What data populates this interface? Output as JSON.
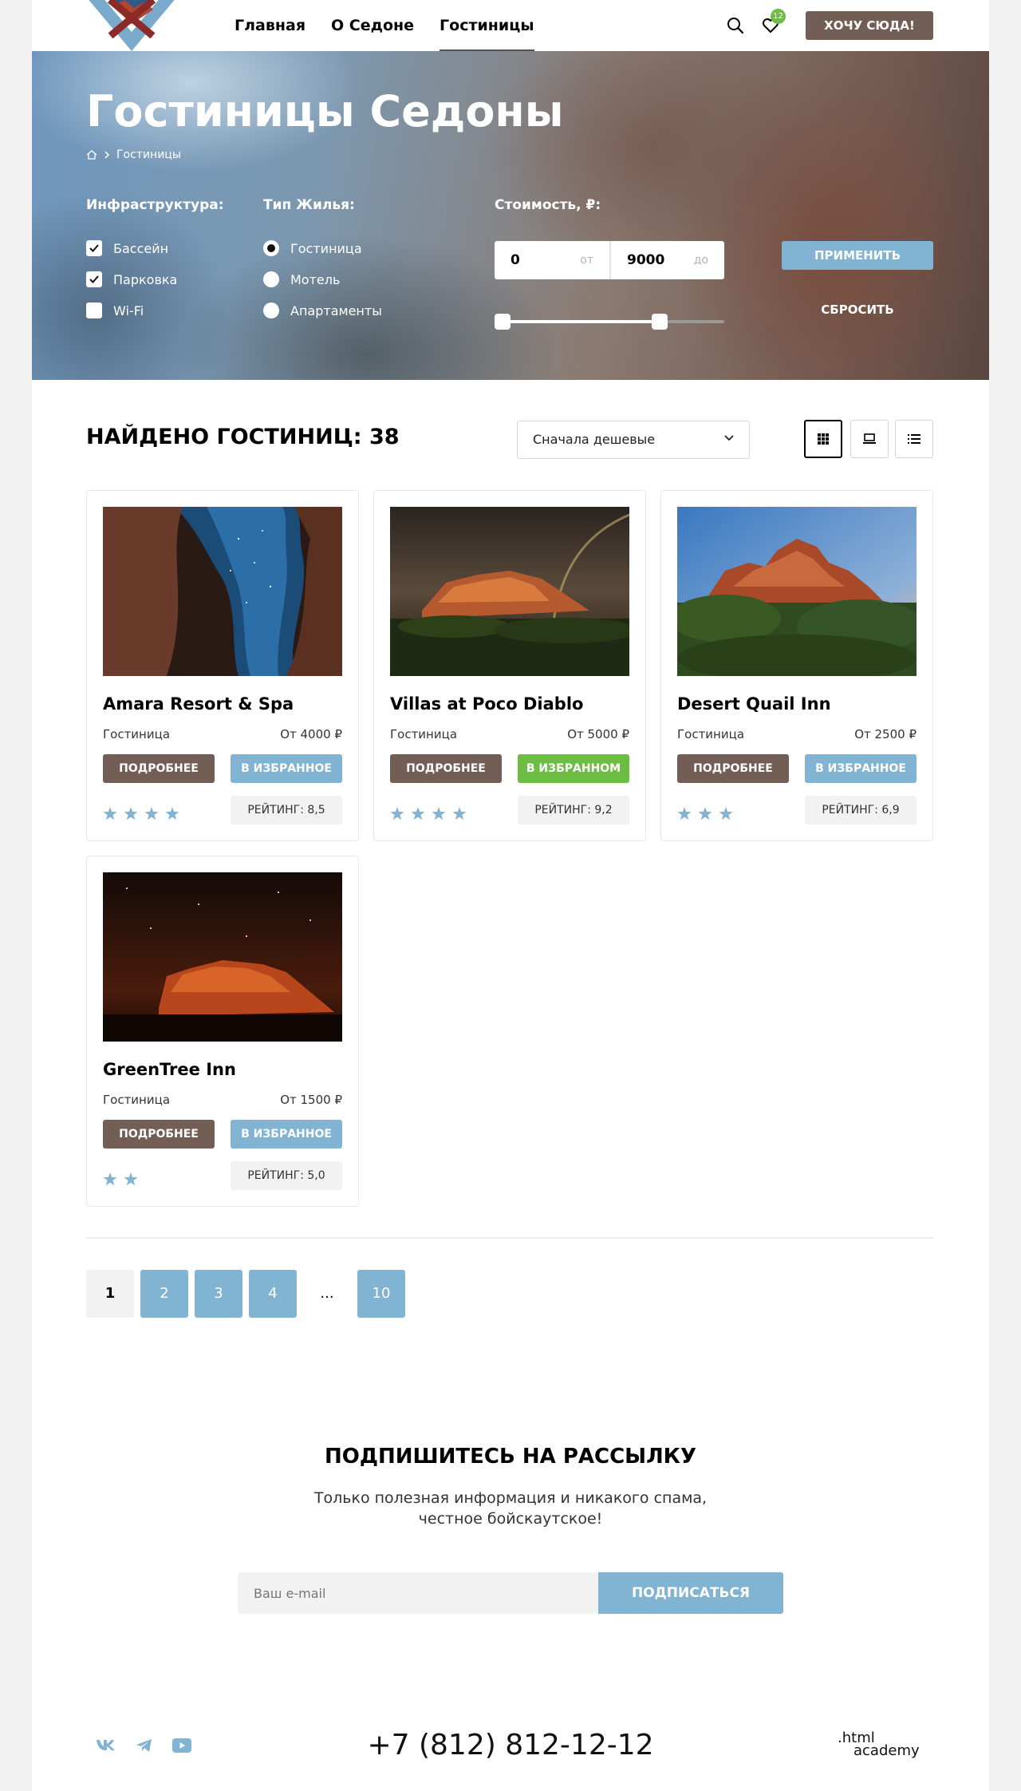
{
  "header": {
    "logo_alt": "City of Sedona",
    "nav": [
      {
        "label": "Главная",
        "active": false
      },
      {
        "label": "О Седоне",
        "active": false
      },
      {
        "label": "Гостиницы",
        "active": true
      }
    ],
    "favorites_count": "12",
    "cta_label": "ХОЧУ СЮДА!"
  },
  "hero": {
    "title": "Гостиницы Седоны",
    "breadcrumb_current": "Гостиницы"
  },
  "filters": {
    "infrastructure_title": "Инфраструктура:",
    "infrastructure": [
      {
        "label": "Бассейн",
        "checked": true
      },
      {
        "label": "Парковка",
        "checked": true
      },
      {
        "label": "Wi-Fi",
        "checked": false
      }
    ],
    "type_title": "Тип Жилья:",
    "types": [
      {
        "label": "Гостиница",
        "selected": true
      },
      {
        "label": "Мотель",
        "selected": false
      },
      {
        "label": "Апартаменты",
        "selected": false
      }
    ],
    "price_title": "Стоимость, ₽:",
    "price_min": "0",
    "price_min_unit": "от",
    "price_max": "9000",
    "price_max_unit": "до",
    "range_min_fraction": 0.0,
    "range_max_fraction": 0.72,
    "apply_label": "ПРИМЕНИТЬ",
    "reset_label": "СБРОСИТЬ"
  },
  "results": {
    "found_label": "НАЙДЕНО ГОСТИНИЦ: 38",
    "sort_value": "Сначала дешевые",
    "view_modes": [
      "grid",
      "card",
      "list"
    ],
    "active_view": "grid"
  },
  "hotels": [
    {
      "name": "Amara Resort & Spa",
      "type": "Гостиница",
      "price": "От 4000 ₽",
      "more_label": "ПОДРОБНЕЕ",
      "fav_label": "В ИЗБРАННОЕ",
      "in_favorites": false,
      "stars": 4,
      "rating": "РЕЙТИНГ: 8,5",
      "image": "cave-night-sky"
    },
    {
      "name": "Villas at Poco Diablo",
      "type": "Гостиница",
      "price": "От 5000 ₽",
      "more_label": "ПОДРОБНЕЕ",
      "fav_label": "В ИЗБРАННОМ",
      "in_favorites": true,
      "stars": 4,
      "rating": "РЕЙТИНГ: 9,2",
      "image": "red-rock-rainbow"
    },
    {
      "name": "Desert Quail Inn",
      "type": "Гостиница",
      "price": "От 2500 ₽",
      "more_label": "ПОДРОБНЕЕ",
      "fav_label": "В ИЗБРАННОЕ",
      "in_favorites": false,
      "stars": 3,
      "rating": "РЕЙТИНГ: 6,9",
      "image": "red-rock-daylight"
    },
    {
      "name": "GreenTree Inn",
      "type": "Гостиница",
      "price": "От 1500 ₽",
      "more_label": "ПОДРОБНЕЕ",
      "fav_label": "В ИЗБРАННОЕ",
      "in_favorites": false,
      "stars": 2,
      "rating": "РЕЙТИНГ: 5,0",
      "image": "red-rock-night"
    }
  ],
  "pagination": {
    "pages": [
      "1",
      "2",
      "3",
      "4",
      "...",
      "10"
    ],
    "current": "1"
  },
  "subscribe": {
    "title": "ПОДПИШИТЕСЬ НА РАССЫЛКУ",
    "text": "Только полезная информация и никакого спама, честное бойскаутское!",
    "placeholder": "Ваш e-mail",
    "button_label": "ПОДПИСАТЬСЯ"
  },
  "footer": {
    "social": [
      "vk-icon",
      "telegram-icon",
      "youtube-icon"
    ],
    "phone": "+7 (812) 812-12-12",
    "academy_line1": ".html",
    "academy_line2": "academy"
  },
  "colors": {
    "brown": "#725e55",
    "blue": "#81b3d2",
    "green": "#6dbd45",
    "star": "#81b3d2"
  }
}
